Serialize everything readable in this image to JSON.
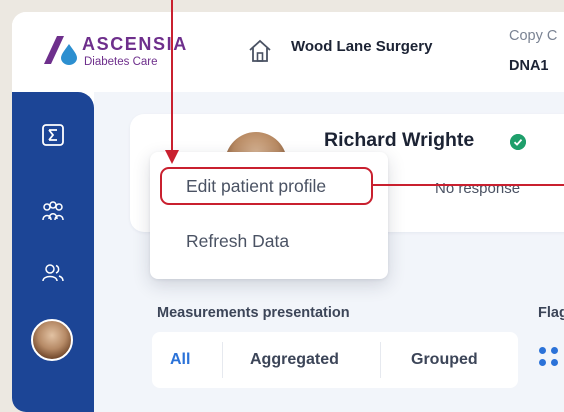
{
  "header": {
    "brand_name": "ASCENSIA",
    "brand_sub": "Diabetes Care",
    "practice_name": "Wood Lane Surgery",
    "copy_label": "Copy C",
    "copy_value": "DNA1"
  },
  "sidebar": {
    "items": [
      {
        "icon": "sigma-icon"
      },
      {
        "icon": "group-icon"
      },
      {
        "icon": "users-icon"
      },
      {
        "icon": "avatar"
      }
    ]
  },
  "patient": {
    "name": "Richard Wrighte",
    "response_status": "No response"
  },
  "menu": {
    "items": [
      "Edit patient profile",
      "Refresh Data"
    ]
  },
  "measurements": {
    "title": "Measurements presentation",
    "options": [
      "All",
      "Aggregated",
      "Grouped"
    ],
    "selected": "All"
  },
  "flags": {
    "title": "Flag"
  },
  "colors": {
    "sidebar": "#1c4596",
    "brand": "#6e2f8c",
    "accent": "#2b72d8",
    "verified": "#1e9f6b",
    "annotation": "#c9202f"
  }
}
